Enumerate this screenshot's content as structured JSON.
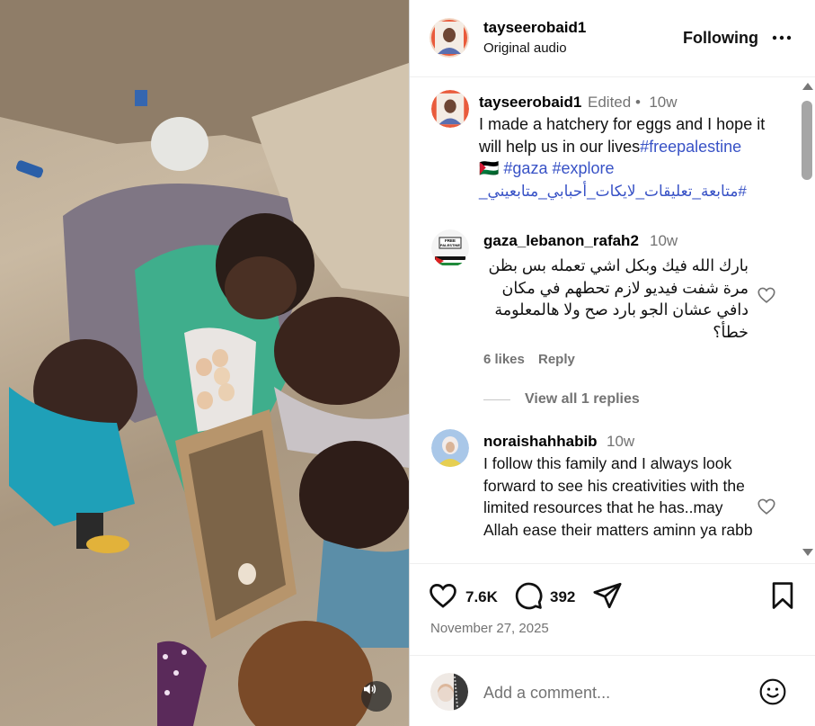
{
  "post": {
    "author": "tayseerobaid1",
    "audio": "Original audio",
    "follow_label": "Following"
  },
  "caption": {
    "username": "tayseerobaid1",
    "edited": "Edited",
    "dot": "•",
    "time": "10w",
    "text": "I made a hatchery for eggs and I hope it will help us in our lives",
    "tags_line1": "#freepalestine",
    "tags_line2": "🇵🇸 #gaza #explore",
    "tags_line3": "#متابعة_تعليقات_لايكات_أحبابي_متابعيني_"
  },
  "comments": [
    {
      "username": "gaza_lebanon_rafah2",
      "time": "10w",
      "text": "بارك الله فيك وبكل اشي تعمله بس بظن مرة شفت فيديو لازم تحطهم في مكان دافي عشان الجو بارد صح ولا هالمعلومة خطأ؟",
      "likes": "6 likes",
      "reply": "Reply",
      "view_replies": "View all 1 replies",
      "avatar_text": "FREE PALESTINE"
    },
    {
      "username": "noraishahhabib",
      "time": "10w",
      "text": "I follow this family and I always look forward to see his creativities with the limited resources that he has..may Allah ease their matters aminn ya rabb"
    }
  ],
  "actions": {
    "likes": "7.6K",
    "comments": "392",
    "date": "November 27, 2025"
  },
  "add_comment": {
    "placeholder": "Add a comment..."
  },
  "icons": {
    "like": "heart-icon",
    "comment": "comment-bubble-icon",
    "share": "paper-plane-icon",
    "save": "bookmark-icon",
    "more": "more-horizontal-icon",
    "emoji": "emoji-smile-icon",
    "mute": "speaker-icon"
  }
}
